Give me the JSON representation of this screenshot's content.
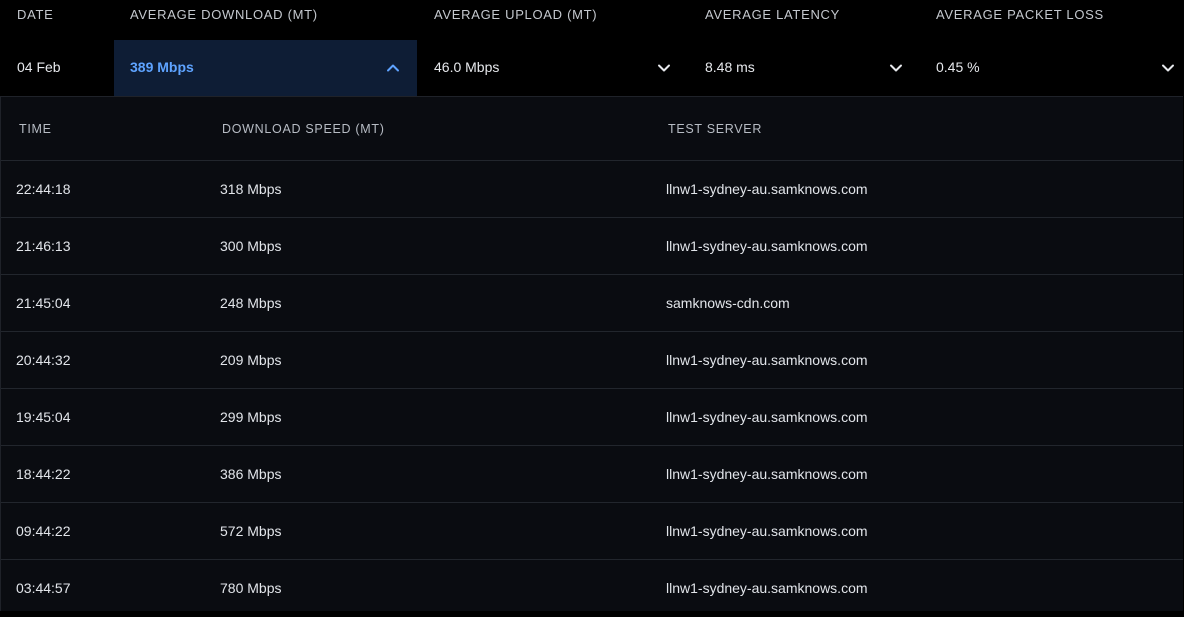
{
  "header": {
    "date": "DATE",
    "avg_download": "AVERAGE DOWNLOAD (MT)",
    "avg_upload": "AVERAGE UPLOAD (MT)",
    "avg_latency": "AVERAGE LATENCY",
    "avg_packet_loss": "AVERAGE PACKET LOSS"
  },
  "summary": {
    "date": "04 Feb",
    "download": "389 Mbps",
    "upload": "46.0 Mbps",
    "latency": "8.48 ms",
    "packet_loss": "0.45 %"
  },
  "detail": {
    "columns": {
      "time": "TIME",
      "speed": "DOWNLOAD SPEED (MT)",
      "server": "TEST SERVER"
    },
    "rows": [
      {
        "time": "22:44:18",
        "speed": "318 Mbps",
        "server": "llnw1-sydney-au.samknows.com"
      },
      {
        "time": "21:46:13",
        "speed": "300 Mbps",
        "server": "llnw1-sydney-au.samknows.com"
      },
      {
        "time": "21:45:04",
        "speed": "248 Mbps",
        "server": "samknows-cdn.com"
      },
      {
        "time": "20:44:32",
        "speed": "209 Mbps",
        "server": "llnw1-sydney-au.samknows.com"
      },
      {
        "time": "19:45:04",
        "speed": "299 Mbps",
        "server": "llnw1-sydney-au.samknows.com"
      },
      {
        "time": "18:44:22",
        "speed": "386 Mbps",
        "server": "llnw1-sydney-au.samknows.com"
      },
      {
        "time": "09:44:22",
        "speed": "572 Mbps",
        "server": "llnw1-sydney-au.samknows.com"
      },
      {
        "time": "03:44:57",
        "speed": "780 Mbps",
        "server": "llnw1-sydney-au.samknows.com"
      }
    ]
  },
  "icons": {
    "download_toggle": "chevron-up-icon",
    "upload_toggle": "chevron-down-icon",
    "latency_toggle": "chevron-down-icon",
    "packet_loss_toggle": "chevron-down-icon"
  },
  "colors": {
    "background": "#000000",
    "panel": "#0a0c11",
    "active_cell": "#0e1d35",
    "accent": "#5ea3ff",
    "divider": "#22262d"
  }
}
